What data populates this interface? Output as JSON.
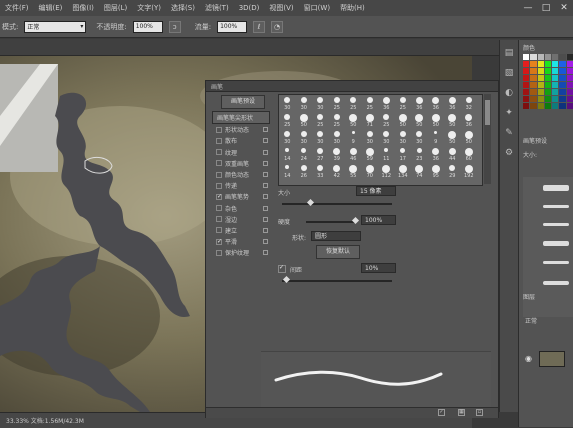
{
  "menubar": {
    "items": [
      "文件(F)",
      "编辑(E)",
      "图像(I)",
      "图层(L)",
      "文字(Y)",
      "选择(S)",
      "滤镜(T)",
      "3D(D)",
      "视图(V)",
      "窗口(W)",
      "帮助(H)"
    ],
    "window_controls": [
      "—",
      "□",
      "✕"
    ]
  },
  "options_bar": {
    "mode_label": "模式:",
    "mode_value": "正常",
    "opacity_label": "不透明度:",
    "opacity_value": "100%",
    "flow_label": "流量:",
    "flow_value": "100%"
  },
  "status": {
    "text": "33.33%   文档:1.56M/42.3M"
  },
  "brush_panel": {
    "title": "画笔",
    "presets_button": "画笔预设",
    "options": [
      {
        "label": "画笔笔尖形状",
        "checked": false,
        "selected": true,
        "header": true
      },
      {
        "label": "形状动态",
        "checked": false
      },
      {
        "label": "散布",
        "checked": false
      },
      {
        "label": "纹理",
        "checked": false
      },
      {
        "label": "双重画笔",
        "checked": false
      },
      {
        "label": "颜色动态",
        "checked": false
      },
      {
        "label": "传递",
        "checked": false
      },
      {
        "label": "画笔笔势",
        "checked": true
      },
      {
        "label": "杂色",
        "checked": false
      },
      {
        "label": "湿边",
        "checked": false
      },
      {
        "label": "建立",
        "checked": false
      },
      {
        "label": "平滑",
        "checked": true
      },
      {
        "label": "保护纹理",
        "checked": false
      }
    ],
    "tips": [
      "30",
      "30",
      "30",
      "25",
      "25",
      "25",
      "36",
      "25",
      "36",
      "36",
      "36",
      "32",
      "25",
      "50",
      "25",
      "25",
      "50",
      "71",
      "25",
      "50",
      "50",
      "50",
      "50",
      "36",
      "30",
      "30",
      "30",
      "30",
      "9",
      "30",
      "30",
      "30",
      "30",
      "9",
      "50",
      "50",
      "14",
      "24",
      "27",
      "39",
      "46",
      "59",
      "11",
      "17",
      "23",
      "36",
      "44",
      "60",
      "14",
      "26",
      "33",
      "42",
      "55",
      "70",
      "112",
      "134",
      "74",
      "95",
      "29",
      "192"
    ],
    "size_label": "大小",
    "size_value": "15 像素",
    "hardness_label": "硬度",
    "hardness_value": "100%",
    "shape_label": "形状:",
    "shape_value": "圆形",
    "reset_button": "恢复默认",
    "spacing_label": "间距",
    "spacing_value": "10%",
    "spacing_checked": true
  },
  "right_panel": {
    "color_tab": "颜色",
    "presets_tab": "画笔预设",
    "size_label": "大小:",
    "layers_tab": "图层",
    "kind_label": "正常"
  },
  "colors": {
    "panel": "#535353",
    "canvas": "#7a7560",
    "accent_path": "#4b4b4f"
  }
}
